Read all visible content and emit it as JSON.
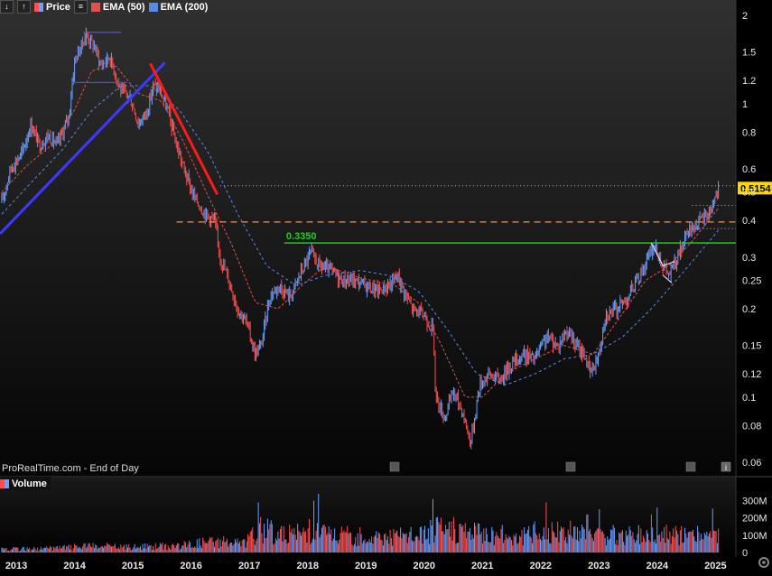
{
  "toolbar": {
    "icons": [
      "down-arrow-icon",
      "up-arrow-icon",
      "list-icon"
    ],
    "price_label": "Price",
    "ema50_label": "EMA (50)",
    "ema200_label": "EMA (200)"
  },
  "source_label": "ProRealTime.com - End of Day",
  "volume_label": "Volume",
  "colors": {
    "background": "#000000",
    "up": "#6aa0ff",
    "down": "#ff4f4f",
    "ema50": "#e05050",
    "ema200": "#5a8ae8",
    "support_line": "#22cc22",
    "dashed_level": "#ff8c3a",
    "trend_up": "#3a3aff",
    "trend_down": "#ff1a1a"
  },
  "chart_data": [
    {
      "type": "line",
      "scale": "log",
      "y_tick_labels": [
        "2",
        "1.5",
        "1.2",
        "1",
        "0.8",
        "0.6",
        "0.5",
        "0.4",
        "0.3",
        "0.25",
        "0.2",
        "0.15",
        "0.12",
        "0.1",
        "0.08",
        "0.06"
      ],
      "y_ticks": [
        2,
        1.5,
        1.2,
        1.0,
        0.8,
        0.6,
        0.5,
        0.4,
        0.3,
        0.25,
        0.2,
        0.15,
        0.12,
        0.1,
        0.08,
        0.06
      ],
      "ylim": [
        0.06,
        2.1
      ],
      "x_tick_labels": [
        "2013",
        "2014",
        "2015",
        "2016",
        "2017",
        "2018",
        "2019",
        "2020",
        "2021",
        "2022",
        "2023",
        "2024",
        "2025"
      ],
      "x_ticks": [
        2013,
        2014,
        2015,
        2016,
        2017,
        2018,
        2019,
        2020,
        2021,
        2022,
        2023,
        2024,
        2025
      ],
      "xlim": [
        2012.72,
        2025.35
      ],
      "price_anchors": [
        [
          2012.75,
          0.46
        ],
        [
          2012.9,
          0.6
        ],
        [
          2013.1,
          0.68
        ],
        [
          2013.25,
          0.85
        ],
        [
          2013.4,
          0.72
        ],
        [
          2013.55,
          0.78
        ],
        [
          2013.7,
          0.72
        ],
        [
          2013.9,
          0.9
        ],
        [
          2014.0,
          1.4
        ],
        [
          2014.1,
          1.55
        ],
        [
          2014.2,
          1.72
        ],
        [
          2014.35,
          1.55
        ],
        [
          2014.45,
          1.35
        ],
        [
          2014.6,
          1.45
        ],
        [
          2014.8,
          1.1
        ],
        [
          2014.95,
          1.05
        ],
        [
          2015.1,
          0.85
        ],
        [
          2015.25,
          0.95
        ],
        [
          2015.35,
          1.15
        ],
        [
          2015.45,
          1.12
        ],
        [
          2015.6,
          0.95
        ],
        [
          2015.75,
          0.72
        ],
        [
          2015.9,
          0.58
        ],
        [
          2016.05,
          0.48
        ],
        [
          2016.25,
          0.42
        ],
        [
          2016.4,
          0.4
        ],
        [
          2016.5,
          0.3
        ],
        [
          2016.65,
          0.25
        ],
        [
          2016.8,
          0.2
        ],
        [
          2016.95,
          0.18
        ],
        [
          2017.1,
          0.14
        ],
        [
          2017.2,
          0.15
        ],
        [
          2017.35,
          0.22
        ],
        [
          2017.5,
          0.24
        ],
        [
          2017.7,
          0.22
        ],
        [
          2017.9,
          0.27
        ],
        [
          2018.05,
          0.31
        ],
        [
          2018.2,
          0.28
        ],
        [
          2018.4,
          0.27
        ],
        [
          2018.6,
          0.25
        ],
        [
          2018.8,
          0.25
        ],
        [
          2019.0,
          0.24
        ],
        [
          2019.2,
          0.23
        ],
        [
          2019.4,
          0.24
        ],
        [
          2019.55,
          0.26
        ],
        [
          2019.65,
          0.23
        ],
        [
          2019.8,
          0.2
        ],
        [
          2020.0,
          0.19
        ],
        [
          2020.15,
          0.17
        ],
        [
          2020.2,
          0.1
        ],
        [
          2020.35,
          0.085
        ],
        [
          2020.5,
          0.105
        ],
        [
          2020.65,
          0.09
        ],
        [
          2020.8,
          0.07
        ],
        [
          2020.95,
          0.11
        ],
        [
          2021.1,
          0.12
        ],
        [
          2021.3,
          0.115
        ],
        [
          2021.5,
          0.13
        ],
        [
          2021.7,
          0.14
        ],
        [
          2021.9,
          0.135
        ],
        [
          2022.1,
          0.16
        ],
        [
          2022.3,
          0.15
        ],
        [
          2022.45,
          0.17
        ],
        [
          2022.6,
          0.15
        ],
        [
          2022.75,
          0.14
        ],
        [
          2022.85,
          0.12
        ],
        [
          2023.0,
          0.14
        ],
        [
          2023.1,
          0.19
        ],
        [
          2023.3,
          0.2
        ],
        [
          2023.5,
          0.22
        ],
        [
          2023.7,
          0.26
        ],
        [
          2023.85,
          0.3
        ],
        [
          2023.95,
          0.33
        ],
        [
          2024.1,
          0.28
        ],
        [
          2024.2,
          0.26
        ],
        [
          2024.35,
          0.3
        ],
        [
          2024.55,
          0.37
        ],
        [
          2024.75,
          0.4
        ],
        [
          2024.9,
          0.43
        ],
        [
          2025.05,
          0.5154
        ]
      ],
      "ema50_anchors": [
        [
          2012.75,
          0.5
        ],
        [
          2013.2,
          0.62
        ],
        [
          2013.6,
          0.72
        ],
        [
          2014.0,
          0.95
        ],
        [
          2014.3,
          1.3
        ],
        [
          2014.7,
          1.35
        ],
        [
          2015.1,
          1.08
        ],
        [
          2015.5,
          1.02
        ],
        [
          2015.9,
          0.72
        ],
        [
          2016.3,
          0.48
        ],
        [
          2016.7,
          0.33
        ],
        [
          2017.1,
          0.21
        ],
        [
          2017.5,
          0.2
        ],
        [
          2017.9,
          0.24
        ],
        [
          2018.3,
          0.28
        ],
        [
          2018.9,
          0.255
        ],
        [
          2019.5,
          0.24
        ],
        [
          2019.9,
          0.21
        ],
        [
          2020.3,
          0.15
        ],
        [
          2020.7,
          0.1
        ],
        [
          2021.0,
          0.1
        ],
        [
          2021.4,
          0.12
        ],
        [
          2021.9,
          0.135
        ],
        [
          2022.4,
          0.15
        ],
        [
          2022.9,
          0.14
        ],
        [
          2023.3,
          0.18
        ],
        [
          2023.8,
          0.25
        ],
        [
          2024.2,
          0.28
        ],
        [
          2024.6,
          0.34
        ],
        [
          2025.05,
          0.44
        ]
      ],
      "ema200_anchors": [
        [
          2012.75,
          0.42
        ],
        [
          2013.3,
          0.55
        ],
        [
          2013.8,
          0.7
        ],
        [
          2014.3,
          0.95
        ],
        [
          2014.8,
          1.15
        ],
        [
          2015.3,
          1.15
        ],
        [
          2015.8,
          0.95
        ],
        [
          2016.3,
          0.68
        ],
        [
          2016.8,
          0.42
        ],
        [
          2017.3,
          0.28
        ],
        [
          2017.8,
          0.24
        ],
        [
          2018.3,
          0.26
        ],
        [
          2018.9,
          0.27
        ],
        [
          2019.4,
          0.26
        ],
        [
          2019.9,
          0.23
        ],
        [
          2020.4,
          0.17
        ],
        [
          2020.9,
          0.12
        ],
        [
          2021.4,
          0.11
        ],
        [
          2021.9,
          0.12
        ],
        [
          2022.4,
          0.135
        ],
        [
          2022.9,
          0.14
        ],
        [
          2023.4,
          0.16
        ],
        [
          2023.9,
          0.2
        ],
        [
          2024.4,
          0.26
        ],
        [
          2025.05,
          0.37
        ]
      ],
      "annotations": {
        "support_label": "0.3350",
        "support_value": 0.335,
        "support_x_start": 2017.6,
        "dashed_level": 0.395,
        "dashed_x_start": 2015.75,
        "dotted_level_top": 0.525,
        "dotted_level_mid": 0.45,
        "dotted_level_low": 0.375,
        "dotted_top_x_start": 2016.5,
        "dotted_low_x_start": 2024.6,
        "last_price_label": "0.5154",
        "last_price": 0.5154,
        "top_band": 1.75,
        "top_band_x": [
          2014.15,
          2014.8
        ],
        "mid_band": 1.18,
        "mid_band_x": [
          2013.95,
          2014.9
        ],
        "trend_up_line": [
          [
            2012.72,
            0.36
          ],
          [
            2015.55,
            1.38
          ]
        ],
        "trend_down_line": [
          [
            2015.3,
            1.37
          ],
          [
            2016.45,
            0.49
          ]
        ],
        "triangle": [
          [
            2023.9,
            0.335
          ],
          [
            2024.1,
            0.28
          ],
          [
            2024.3,
            0.29
          ]
        ],
        "triangle_tail": [
          [
            2024.1,
            0.26
          ],
          [
            2024.25,
            0.245
          ]
        ]
      }
    },
    {
      "type": "bar",
      "title": "Volume",
      "y_tick_labels": [
        "300M",
        "200M",
        "100M",
        "0"
      ],
      "y_ticks": [
        300000000,
        200000000,
        100000000,
        0
      ],
      "ylim": [
        0,
        350000000
      ],
      "volume_profile": [
        [
          2012.75,
          20000000
        ],
        [
          2013.5,
          25000000
        ],
        [
          2014.2,
          40000000
        ],
        [
          2015.0,
          35000000
        ],
        [
          2015.8,
          45000000
        ],
        [
          2016.3,
          70000000
        ],
        [
          2016.9,
          60000000
        ],
        [
          2017.2,
          150000000
        ],
        [
          2017.6,
          110000000
        ],
        [
          2018.1,
          140000000
        ],
        [
          2018.5,
          110000000
        ],
        [
          2019.0,
          100000000
        ],
        [
          2019.5,
          105000000
        ],
        [
          2019.9,
          110000000
        ],
        [
          2020.2,
          150000000
        ],
        [
          2020.6,
          140000000
        ],
        [
          2021.0,
          130000000
        ],
        [
          2021.5,
          110000000
        ],
        [
          2022.0,
          120000000
        ],
        [
          2022.5,
          130000000
        ],
        [
          2023.0,
          110000000
        ],
        [
          2023.5,
          115000000
        ],
        [
          2024.0,
          120000000
        ],
        [
          2024.5,
          110000000
        ],
        [
          2025.05,
          100000000
        ]
      ],
      "volume_spikes": [
        [
          2017.15,
          290000000
        ],
        [
          2018.1,
          300000000
        ],
        [
          2018.18,
          340000000
        ],
        [
          2020.15,
          310000000
        ],
        [
          2020.7,
          170000000
        ],
        [
          2021.9,
          180000000
        ],
        [
          2022.1,
          290000000
        ],
        [
          2022.8,
          220000000
        ],
        [
          2023.0,
          250000000
        ],
        [
          2023.9,
          220000000
        ],
        [
          2024.0,
          260000000
        ],
        [
          2024.95,
          255000000
        ]
      ]
    }
  ]
}
